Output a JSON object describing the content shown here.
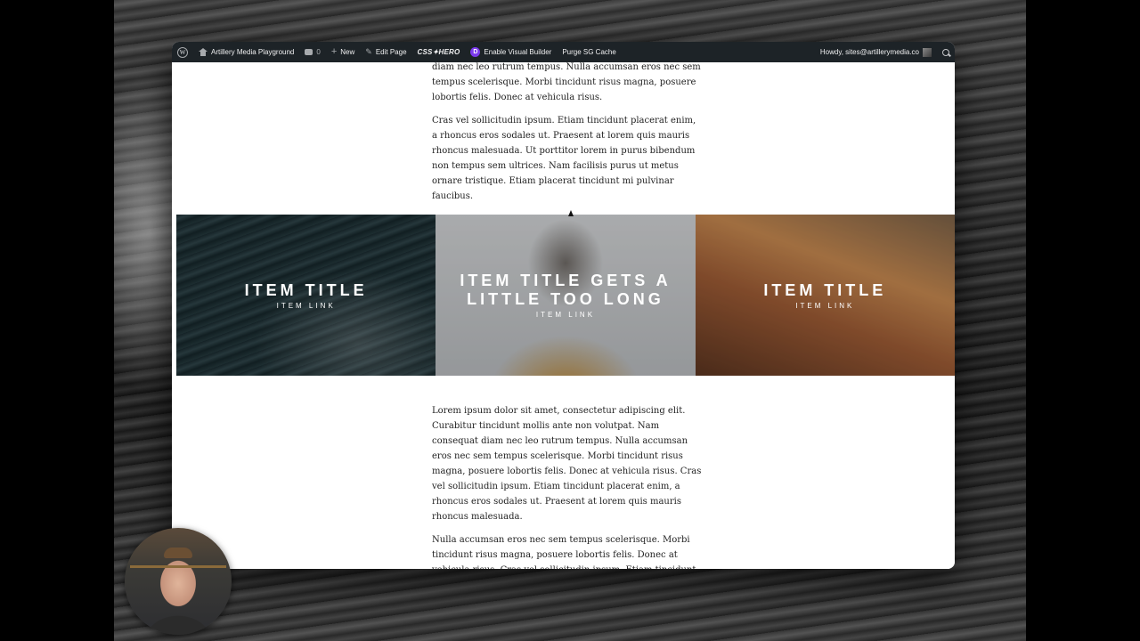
{
  "admin_bar": {
    "site_name": "Artillery Media Playground",
    "comments_count": "0",
    "new_label": "New",
    "edit_page_label": "Edit Page",
    "css_hero_label": "CSS✦HERO",
    "divi_icon_letter": "D",
    "visual_builder_label": "Enable Visual Builder",
    "purge_cache_label": "Purge SG Cache",
    "howdy_label": "Howdy, sites@artillerymedia.co"
  },
  "content": {
    "top_paragraphs": [
      "diam nec leo rutrum tempus. Nulla accumsan eros nec sem tempus scelerisque. Morbi tincidunt risus magna, posuere lobortis felis. Donec at vehicula risus.",
      "Cras vel sollicitudin ipsum. Etiam tincidunt placerat enim, a rhoncus eros sodales ut. Praesent at lorem quis mauris rhoncus malesuada. Ut porttitor lorem in purus bibendum non tempus sem ultrices. Nam facilisis purus ut metus ornare tristique. Etiam placerat tincidunt mi pulvinar faucibus."
    ],
    "cards": [
      {
        "title": "ITEM TITLE",
        "link": "ITEM LINK"
      },
      {
        "title": "ITEM TITLE GETS A LITTLE TOO LONG",
        "link": "ITEM LINK"
      },
      {
        "title": "ITEM TITLE",
        "link": "ITEM LINK"
      }
    ],
    "bottom_paragraphs": [
      "Lorem ipsum dolor sit amet, consectetur adipiscing elit. Curabitur tincidunt mollis ante non volutpat. Nam consequat diam nec leo rutrum tempus. Nulla accumsan eros nec sem tempus scelerisque. Morbi tincidunt risus magna, posuere lobortis felis. Donec at vehicula risus. Cras vel sollicitudin ipsum. Etiam tincidunt placerat enim, a rhoncus eros sodales ut. Praesent at lorem quis mauris rhoncus malesuada.",
      "Nulla accumsan eros nec sem tempus scelerisque. Morbi tincidunt risus magna, posuere lobortis felis. Donec at vehicula risus. Cras vel sollicitudin ipsum. Etiam tincidunt placerat enim,"
    ]
  },
  "colors": {
    "admin_bar_bg": "#1d2327",
    "divi_purple": "#7c3aed"
  }
}
